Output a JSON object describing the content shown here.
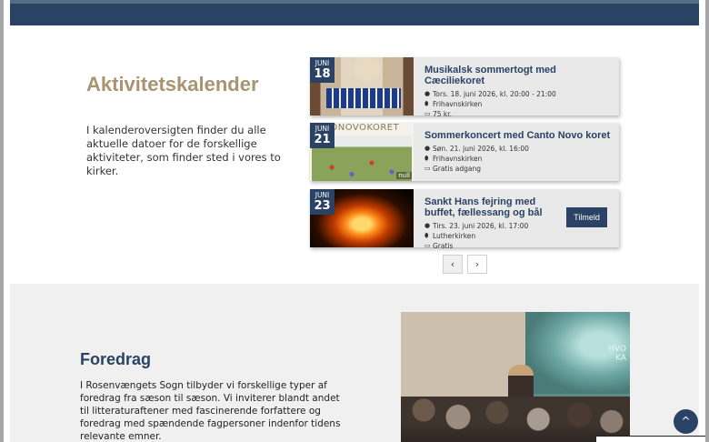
{
  "calendar": {
    "title": "Aktivitetskalender",
    "description": "I kalenderoversigten finder du alle aktuelle datoer for de forskellige aktiviteter, som finder sted i vores to kirker."
  },
  "events": [
    {
      "month": "JUNI",
      "day": "18",
      "title": "Musikalsk sommertogt med Cæciliekoret",
      "datetime": "Tors. 18. juni 2026, kl. 20:00 - 21:00",
      "location": "Frihavnskirken",
      "price": "75 kr."
    },
    {
      "month": "JUNI",
      "day": "21",
      "title": "Sommerkoncert med Canto Novo koret",
      "datetime": "Søn. 21. juni 2026, kl. 16:00",
      "location": "Frihavnskirken",
      "price": "Gratis adgang",
      "image_text": "TONOVOKORET",
      "image_caption": "null"
    },
    {
      "month": "JUNI",
      "day": "23",
      "title": "Sankt Hans fejring med buffet, fællessang og bål",
      "datetime": "Tirs. 23. juni 2026, kl. 17:00",
      "location": "Lutherkirken",
      "price": "Gratis",
      "button_label": "Tilmeld"
    }
  ],
  "pager": {
    "prev": "‹",
    "next": "›"
  },
  "lecture": {
    "title": "Foredrag",
    "description": "I Rosenvængets Sogn tilbyder vi forskellige typer af foredrag fra sæson til sæson. Vi inviterer blandt andet til litteraturaftener med fascinerende forfattere og foredrag med spændende fagpersoner indenfor tidens relevante emner.",
    "photo_screen_text": "HVO\nKA"
  },
  "scroll_top": "^",
  "colors": {
    "navy": "#2a4263",
    "gold": "#a89470",
    "card": "#e9e9e9",
    "section": "#f0f0f0"
  },
  "icons": {
    "time": "clock-icon",
    "location": "pin-icon",
    "price": "ticket-icon"
  }
}
